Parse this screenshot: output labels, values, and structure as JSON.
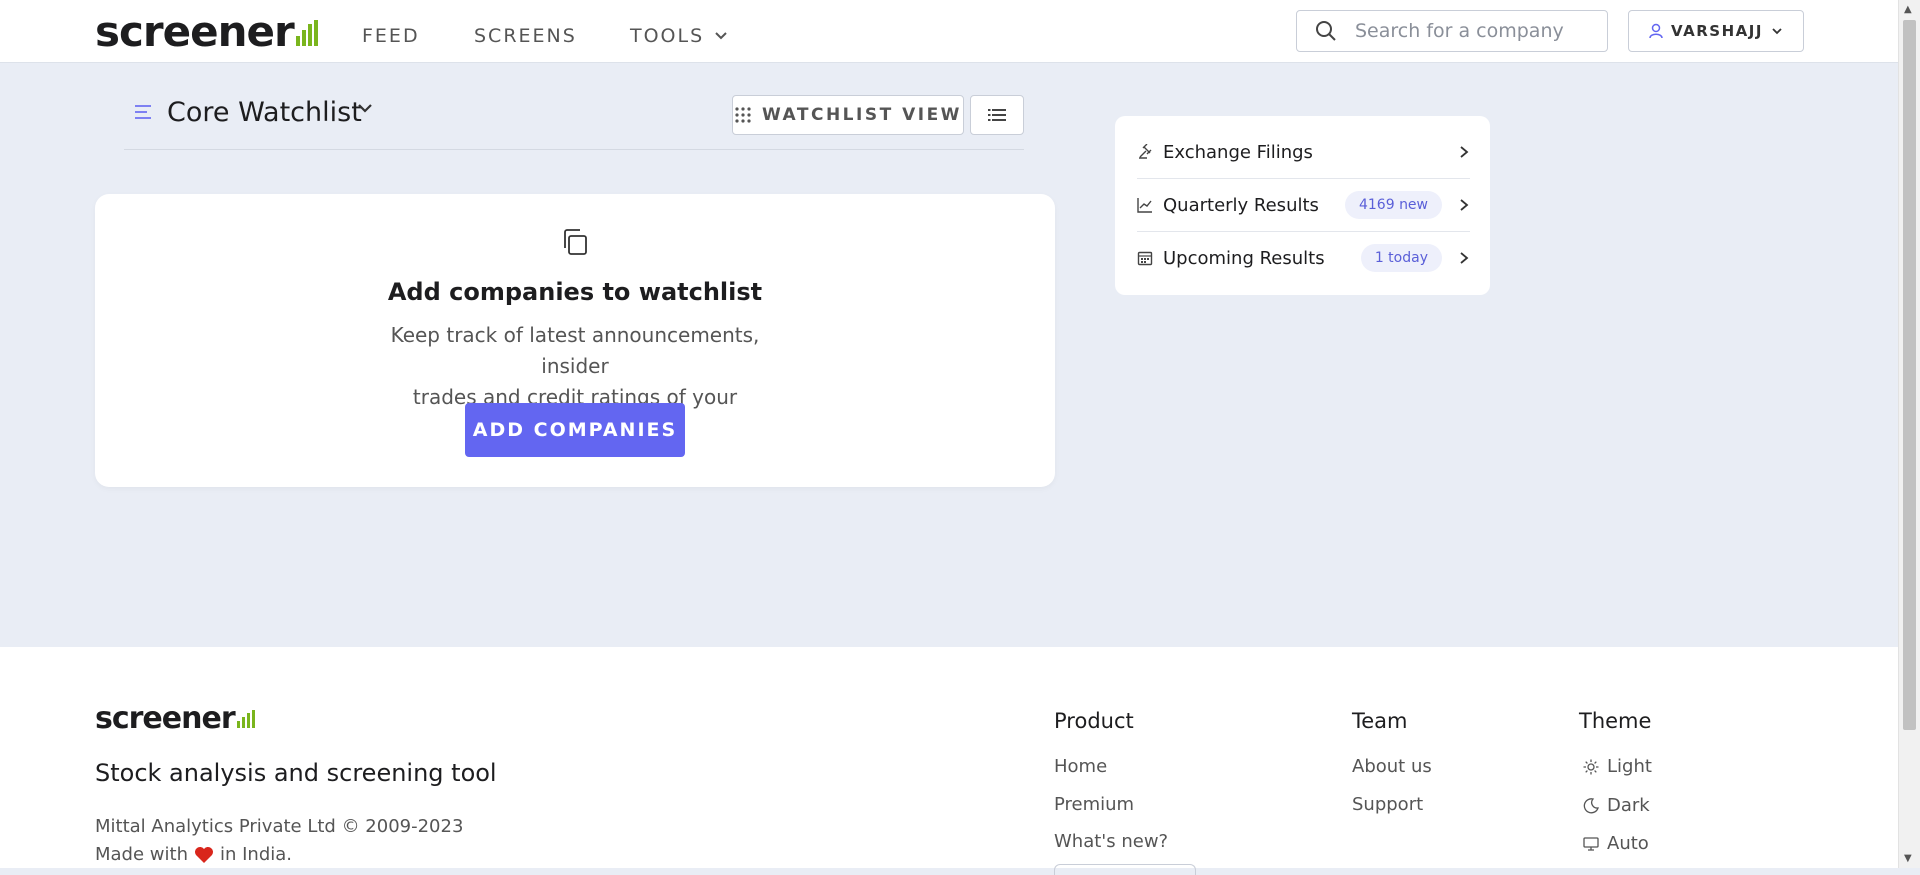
{
  "header": {
    "logo_text": "screener",
    "nav": {
      "feed": "FEED",
      "screens": "SCREENS",
      "tools": "TOOLS"
    },
    "search_placeholder": "Search for a company",
    "user_name": "VARSHAJJ",
    "brand_color": "#7ab51d"
  },
  "watchlist": {
    "title": "Core Watchlist",
    "view_button": "WATCHLIST VIEW"
  },
  "empty_state": {
    "title": "Add companies to watchlist",
    "description_line1": "Keep track of latest announcements, insider",
    "description_line2": "trades and credit ratings of your companies.",
    "button": "ADD COMPANIES",
    "accent_color": "#6366f1"
  },
  "side_panel": {
    "items": [
      {
        "label": "Exchange Filings",
        "badge": "",
        "icon": "gavel-icon"
      },
      {
        "label": "Quarterly Results",
        "badge": "4169 new",
        "icon": "chart-line-icon"
      },
      {
        "label": "Upcoming Results",
        "badge": "1 today",
        "icon": "calendar-icon"
      }
    ]
  },
  "footer": {
    "logo_text": "screener",
    "tagline": "Stock analysis and screening tool",
    "copyright": "Mittal Analytics Private Ltd © 2009-2023",
    "made_prefix": "Made with",
    "made_suffix": "in India.",
    "product": {
      "title": "Product",
      "links": [
        "Home",
        "Premium",
        "What's new?"
      ]
    },
    "team": {
      "title": "Team",
      "links": [
        "About us",
        "Support"
      ]
    },
    "theme": {
      "title": "Theme",
      "options": [
        "Light",
        "Dark",
        "Auto"
      ]
    }
  }
}
